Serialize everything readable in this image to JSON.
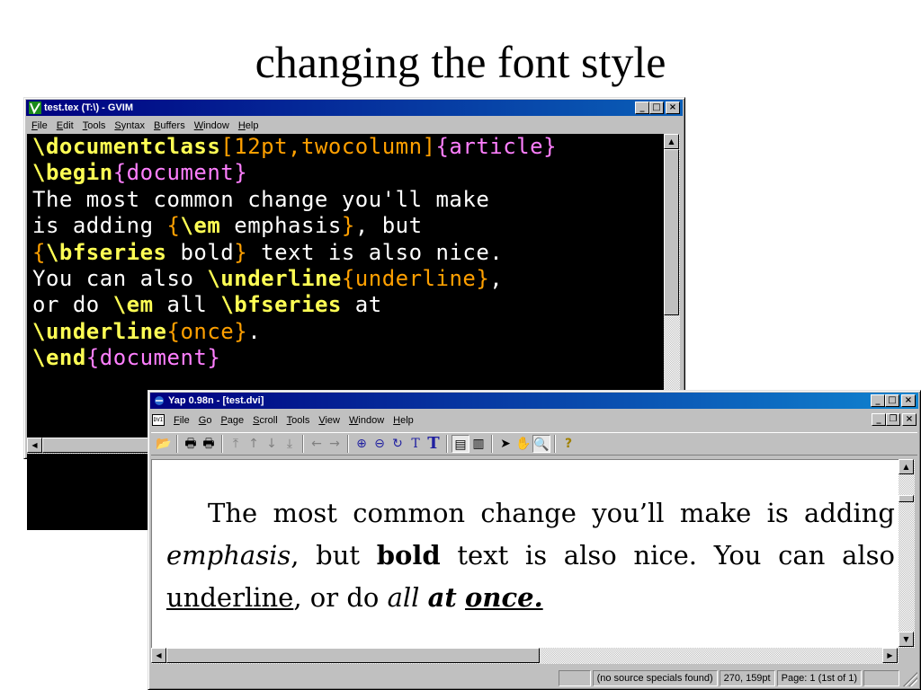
{
  "slide": {
    "title": "changing the font style"
  },
  "gvim": {
    "title": "test.tex (T:\\) - GVIM",
    "menu": [
      "File",
      "Edit",
      "Tools",
      "Syntax",
      "Buffers",
      "Window",
      "Help"
    ],
    "controls": {
      "minimize": "_",
      "maximize": "□",
      "close": "×"
    },
    "lines": [
      [
        {
          "t": "\\documentclass",
          "c": "kw"
        },
        {
          "t": "[12pt,twocolumn]",
          "c": "br"
        },
        {
          "t": "{article}",
          "c": "pu"
        }
      ],
      [
        {
          "t": "\\begin",
          "c": "kw"
        },
        {
          "t": "{document}",
          "c": "pu"
        }
      ],
      [
        {
          "t": "The most common change you'll make",
          "c": ""
        }
      ],
      [
        {
          "t": "is adding ",
          "c": ""
        },
        {
          "t": "{",
          "c": "br"
        },
        {
          "t": "\\em",
          "c": "kw"
        },
        {
          "t": " emphasis",
          "c": ""
        },
        {
          "t": "}",
          "c": "br"
        },
        {
          "t": ", but",
          "c": ""
        }
      ],
      [
        {
          "t": "{",
          "c": "br"
        },
        {
          "t": "\\bfseries",
          "c": "kw"
        },
        {
          "t": " bold",
          "c": ""
        },
        {
          "t": "}",
          "c": "br"
        },
        {
          "t": " text is also nice.",
          "c": ""
        }
      ],
      [
        {
          "t": "You can also ",
          "c": ""
        },
        {
          "t": "\\underline",
          "c": "kw"
        },
        {
          "t": "{underline}",
          "c": "br"
        },
        {
          "t": ",",
          "c": ""
        }
      ],
      [
        {
          "t": "or do ",
          "c": ""
        },
        {
          "t": "\\em",
          "c": "kw"
        },
        {
          "t": " all ",
          "c": ""
        },
        {
          "t": "\\bfseries",
          "c": "kw"
        },
        {
          "t": " at",
          "c": ""
        }
      ],
      [
        {
          "t": "\\underline",
          "c": "kw"
        },
        {
          "t": "{once}",
          "c": "br"
        },
        {
          "t": ".",
          "c": ""
        }
      ],
      [
        {
          "t": "\\end",
          "c": "kw"
        },
        {
          "t": "{document}",
          "c": "pu"
        }
      ]
    ]
  },
  "yap": {
    "title": "Yap 0.98n - [test.dvi]",
    "doc_icon": "DVI",
    "menu": [
      "File",
      "Go",
      "Page",
      "Scroll",
      "Tools",
      "View",
      "Window",
      "Help"
    ],
    "controls": {
      "minimize": "_",
      "maximize": "□",
      "close": "×",
      "restore": "❐"
    },
    "toolbar_icons": [
      {
        "name": "open-icon",
        "glyph": "📂",
        "sep_after": true
      },
      {
        "name": "print-icon",
        "glyph": "🖶"
      },
      {
        "name": "print-setup-icon",
        "glyph": "🖶",
        "sep_after": true
      },
      {
        "name": "first-page-icon",
        "glyph": "⤒",
        "dim": true
      },
      {
        "name": "page-up-icon",
        "glyph": "↑",
        "dim": true
      },
      {
        "name": "page-down-icon",
        "glyph": "↓",
        "dim": true
      },
      {
        "name": "last-page-icon",
        "glyph": "⤓",
        "dim": true,
        "sep_after": true
      },
      {
        "name": "back-icon",
        "glyph": "←",
        "dim": true
      },
      {
        "name": "forward-icon",
        "glyph": "→",
        "dim": true,
        "sep_after": true
      },
      {
        "name": "zoom-in-icon",
        "glyph": "⊕",
        "blue": true
      },
      {
        "name": "zoom-out-icon",
        "glyph": "⊖",
        "blue": true
      },
      {
        "name": "refresh-icon",
        "glyph": "↻",
        "blue": true
      },
      {
        "name": "small-font-icon",
        "glyph": "T",
        "blue": true
      },
      {
        "name": "large-font-icon",
        "glyph": "T",
        "blue": true,
        "sep_after": true
      },
      {
        "name": "single-page-icon",
        "glyph": "▤",
        "pressed": true
      },
      {
        "name": "double-page-icon",
        "glyph": "▥",
        "sep_after": true
      },
      {
        "name": "pointer-icon",
        "glyph": "➤"
      },
      {
        "name": "hand-icon",
        "glyph": "✋"
      },
      {
        "name": "magnifier-icon",
        "glyph": "🔍",
        "pressed": true,
        "sep_after": true
      },
      {
        "name": "help-icon",
        "glyph": "?"
      }
    ],
    "paragraph": {
      "p1": "The most common change you’ll make is adding ",
      "emph": "emphasis",
      "p2": ", but ",
      "bold": "bold",
      "p3": " text is also nice. You can also ",
      "underline": "underline",
      "p4": ", or do ",
      "all": "all",
      "p5": " ",
      "at": "at",
      "p6": " ",
      "once": "once.",
      "p7": ""
    },
    "status": {
      "empty": "",
      "source": "(no source specials found)",
      "position": "270, 159pt",
      "page": "Page: 1 (1st of 1)"
    }
  }
}
